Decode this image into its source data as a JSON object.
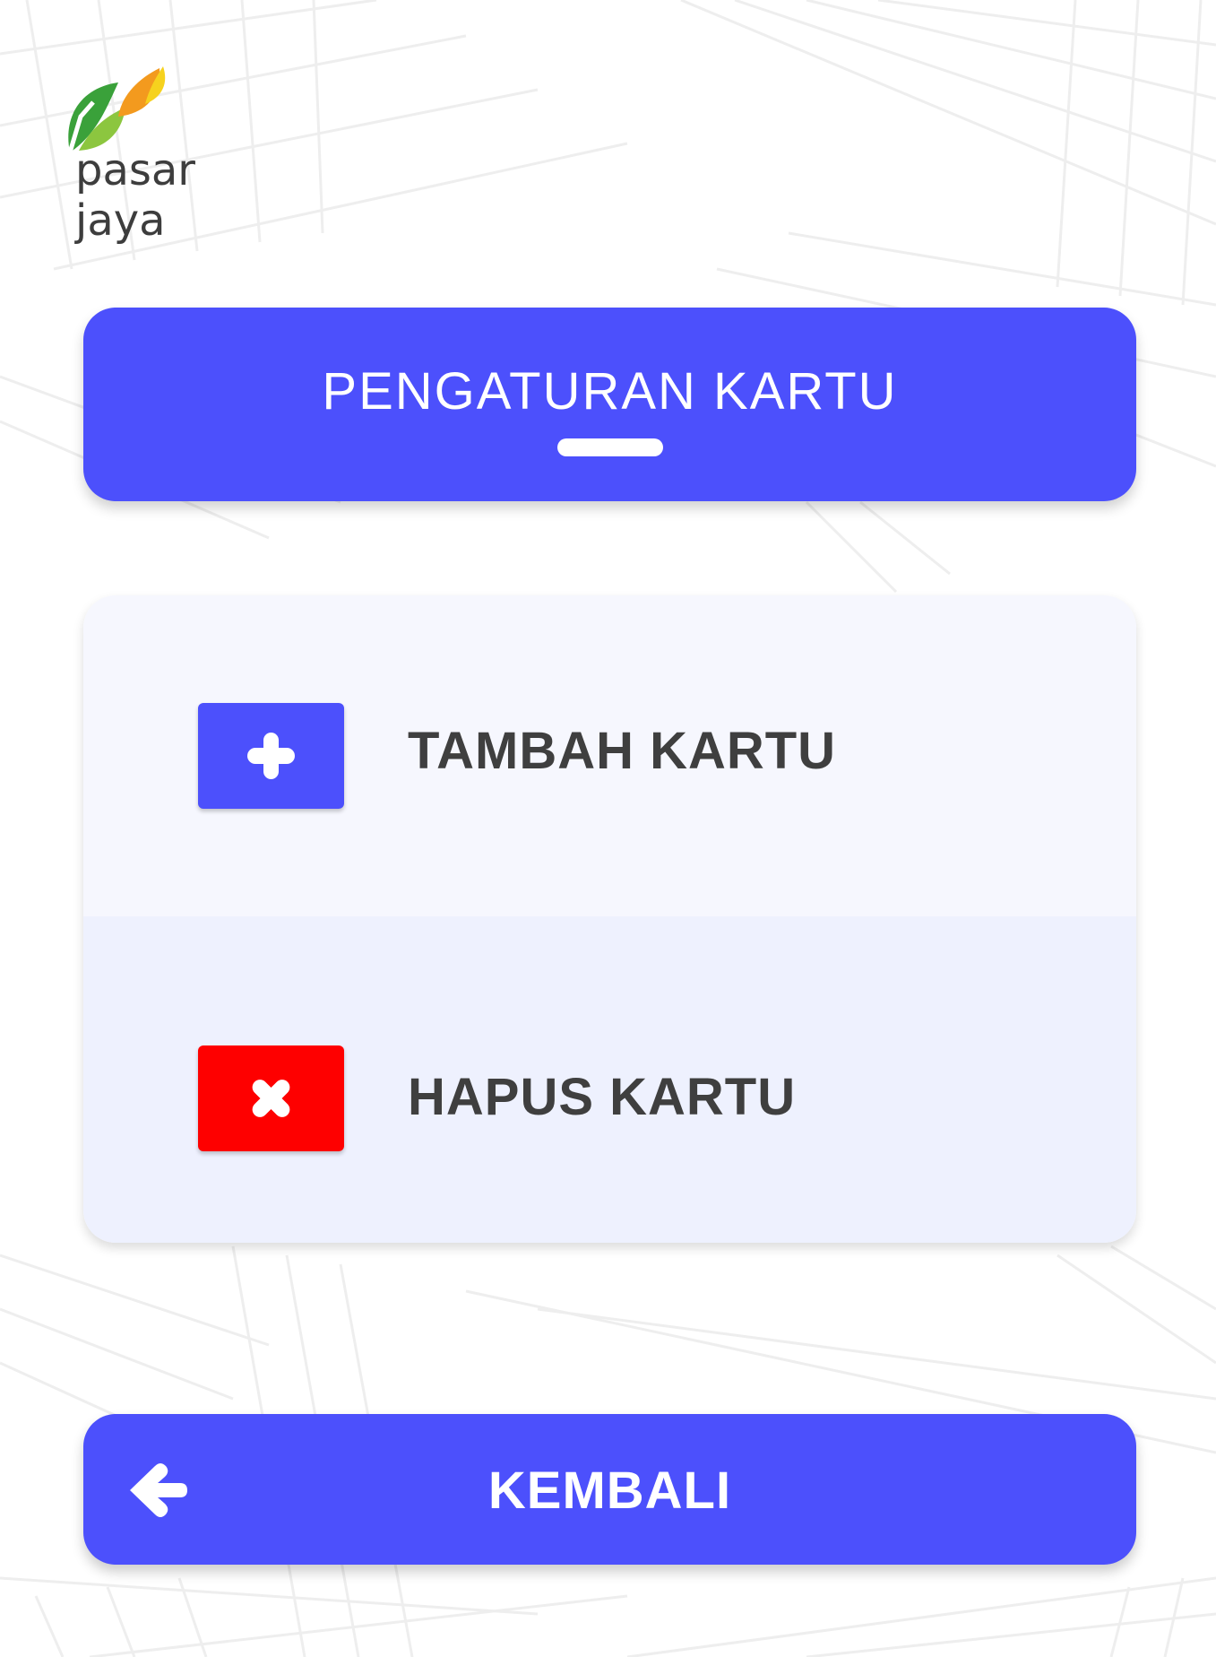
{
  "brand": {
    "name": "pasar jaya",
    "colors": {
      "leaf_green": "#3aa13a",
      "leaf_orange": "#f39a1e",
      "leaf_yellow": "#f6d21e",
      "text": "#3d3d3d"
    }
  },
  "header": {
    "title": "PENGATURAN KARTU",
    "color": "#4c50fc"
  },
  "menu": {
    "items": [
      {
        "label": "TAMBAH KARTU",
        "icon": "plus-icon",
        "color": "#4c50fc"
      },
      {
        "label": "HAPUS KARTU",
        "icon": "close-icon",
        "color": "#fe0000"
      }
    ]
  },
  "footer": {
    "back_label": "KEMBALI",
    "back_icon": "arrow-left-icon",
    "color": "#4c50fc"
  }
}
